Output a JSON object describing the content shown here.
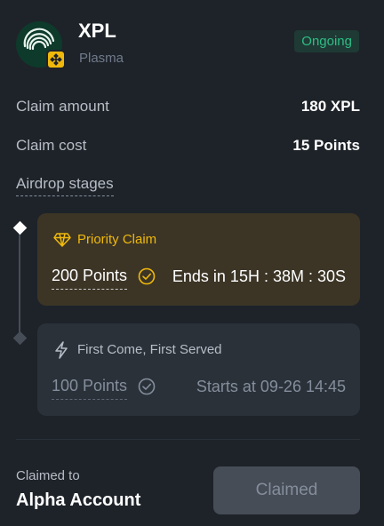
{
  "token": {
    "symbol": "XPL",
    "network": "Plasma",
    "status": "Ongoing",
    "logo_icon": "plasma-logo-icon",
    "chain_icon": "bnb-chain-icon"
  },
  "details": [
    {
      "label": "Claim amount",
      "value": "180 XPL"
    },
    {
      "label": "Claim cost",
      "value": "15 Points"
    }
  ],
  "stages": {
    "label": "Airdrop stages",
    "items": [
      {
        "icon": "diamond-gem-icon",
        "title": "Priority Claim",
        "points": "200 Points",
        "time": "Ends in 15H : 38M : 30S",
        "state": "active"
      },
      {
        "icon": "lightning-icon",
        "title": "First Come, First Served",
        "points": "100 Points",
        "time": "Starts at 09-26 14:45",
        "state": "upcoming"
      }
    ]
  },
  "footer": {
    "claimed_to_label": "Claimed to",
    "claimed_to_value": "Alpha Account",
    "button_label": "Claimed"
  },
  "colors": {
    "background": "#1e2329",
    "accent": "#f0b90b",
    "status_green": "#2ebd85",
    "active_card": "#3c3526",
    "inactive_card": "#2b3139"
  }
}
